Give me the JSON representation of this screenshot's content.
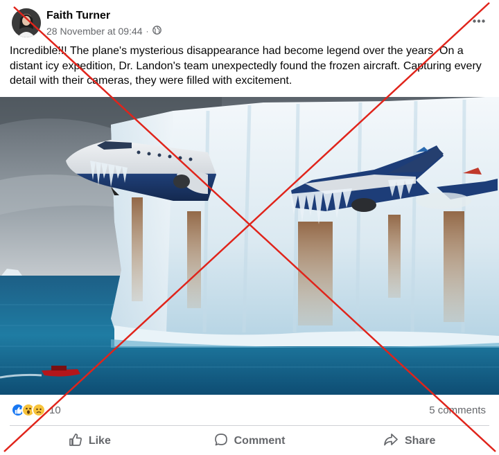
{
  "post": {
    "author": "Faith Turner",
    "timestamp": "28 November at 09:44",
    "audience_icon": "globe-icon",
    "more_icon": "more-options-icon",
    "text": "Incredible!!! The plane's mysterious disappearance had become legend over the years. On a distant icy expedition, Dr. Landon's team unexpectedly found the frozen aircraft. Capturing every detail with their cameras, they were filled with excitement."
  },
  "photo": {
    "description_icon": "photo-plane-iceberg",
    "overlay": "red-x-mark",
    "overlay_color": "#e0241b"
  },
  "engagement": {
    "reaction_icons": [
      "like-reaction-icon",
      "wow-reaction-icon",
      "sad-reaction-icon"
    ],
    "reaction_count": "10",
    "comments_count": "5 comments"
  },
  "actions": {
    "like": "Like",
    "comment": "Comment",
    "share": "Share"
  },
  "colors": {
    "text_primary": "#050505",
    "text_secondary": "#65676b",
    "like_blue": "#1877f2",
    "divider": "#ced0d4"
  }
}
